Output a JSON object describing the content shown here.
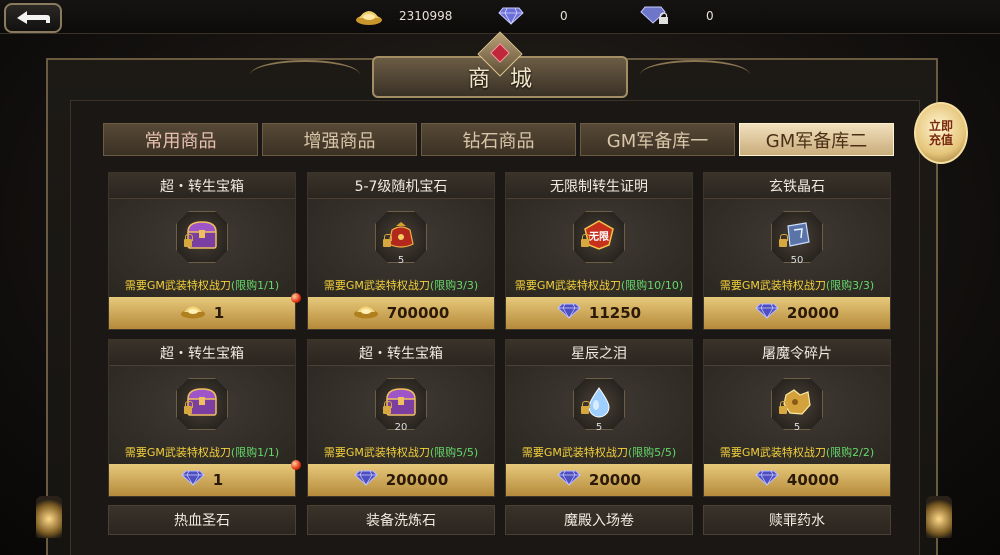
{
  "currencies": {
    "gold": "2310998",
    "diamond": "0",
    "bound_diamond": "0"
  },
  "title": "商城",
  "recharge": {
    "line1": "立即",
    "line2": "充值"
  },
  "tabs": [
    {
      "label": "常用商品",
      "active": false
    },
    {
      "label": "增强商品",
      "active": false
    },
    {
      "label": "钻石商品",
      "active": false
    },
    {
      "label": "GM军备库一",
      "active": false
    },
    {
      "label": "GM军备库二",
      "active": true
    }
  ],
  "items": [
    {
      "name": "超・转生宝箱",
      "count": "",
      "requirement": "需要GM武装特权战刀",
      "limit": "(限购1/1)",
      "currency": "gold",
      "price": "1",
      "item_icon": "treasure-chest-icon",
      "red_dot": true
    },
    {
      "name": "5-7级随机宝石",
      "count": "5",
      "requirement": "需要GM武装特权战刀",
      "limit": "(限购3/3)",
      "currency": "gold",
      "price": "700000",
      "item_icon": "gem-bag-icon",
      "red_dot": false
    },
    {
      "name": "无限制转生证明",
      "count": "",
      "requirement": "需要GM武装特权战刀",
      "limit": "(限购10/10)",
      "currency": "diamond",
      "price": "11250",
      "item_icon": "unlimited-badge-icon",
      "badge_text": "无限",
      "red_dot": false
    },
    {
      "name": "玄铁晶石",
      "count": "50",
      "requirement": "需要GM武装特权战刀",
      "limit": "(限购3/3)",
      "currency": "diamond",
      "price": "20000",
      "item_icon": "iron-crystal-icon",
      "red_dot": false
    },
    {
      "name": "超・转生宝箱",
      "count": "",
      "requirement": "需要GM武装特权战刀",
      "limit": "(限购1/1)",
      "currency": "diamond",
      "price": "1",
      "item_icon": "treasure-chest-icon",
      "red_dot": true
    },
    {
      "name": "超・转生宝箱",
      "count": "20",
      "requirement": "需要GM武装特权战刀",
      "limit": "(限购5/5)",
      "currency": "diamond",
      "price": "200000",
      "item_icon": "treasure-chest-icon",
      "red_dot": false
    },
    {
      "name": "星辰之泪",
      "count": "5",
      "requirement": "需要GM武装特权战刀",
      "limit": "(限购5/5)",
      "currency": "diamond",
      "price": "20000",
      "item_icon": "star-tear-icon",
      "red_dot": false
    },
    {
      "name": "屠魔令碎片",
      "count": "5",
      "requirement": "需要GM武装特权战刀",
      "limit": "(限购2/2)",
      "currency": "diamond",
      "price": "40000",
      "item_icon": "demon-token-shard-icon",
      "red_dot": false
    }
  ],
  "more_items": [
    "热血圣石",
    "装备洗炼石",
    "魔殿入场卷",
    "赎罪药水"
  ],
  "colors": {
    "requirement_yellow": "#f4d23b",
    "limit_green": "#65d86a",
    "price_bar": "#d9b563",
    "active_tab": "#e8d4ab"
  }
}
